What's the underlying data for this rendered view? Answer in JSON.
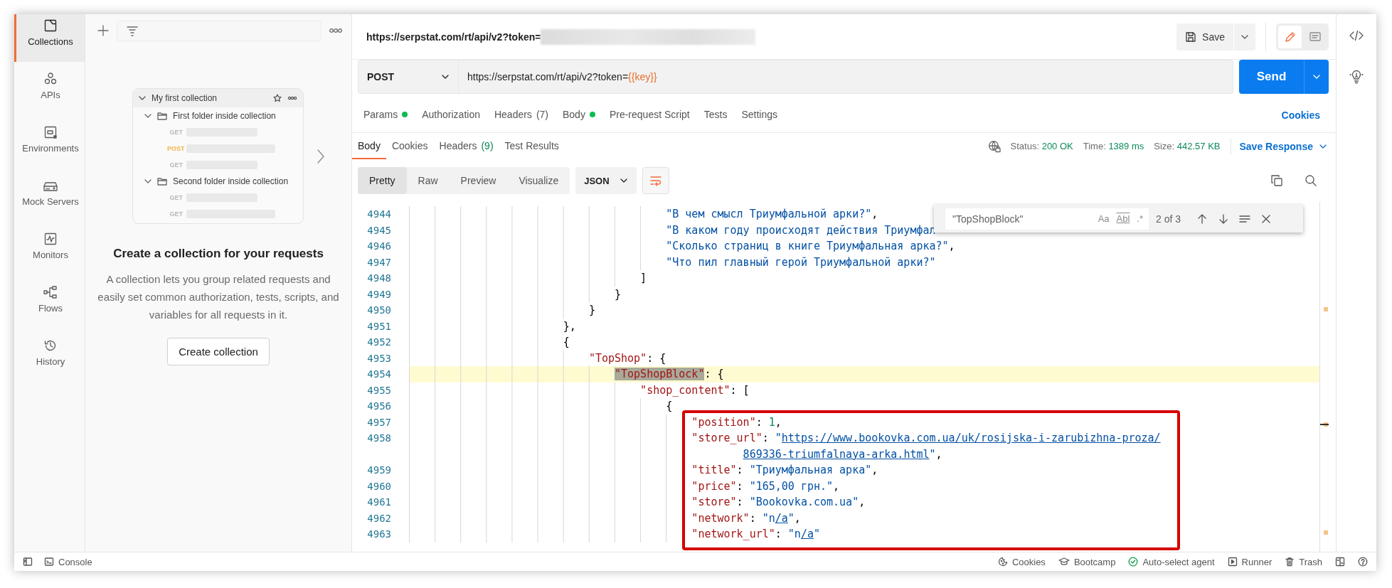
{
  "sidebar": {
    "items": [
      {
        "label": "Collections",
        "kind": "collections",
        "selected": true
      },
      {
        "label": "APIs",
        "kind": "apis",
        "selected": false
      },
      {
        "label": "Environments",
        "kind": "environments",
        "selected": false
      },
      {
        "label": "Mock Servers",
        "kind": "mock_servers",
        "selected": false
      },
      {
        "label": "Monitors",
        "kind": "monitors",
        "selected": false
      },
      {
        "label": "Flows",
        "kind": "flows",
        "selected": false
      },
      {
        "label": "History",
        "kind": "history",
        "selected": false
      }
    ]
  },
  "collections_panel": {
    "illustration": {
      "title": "My first collection",
      "folders": [
        {
          "name": "First folder inside collection",
          "requests": [
            {
              "method": "GET",
              "color": "#b8b8b8"
            },
            {
              "method": "POST",
              "color": "#f2b24c"
            },
            {
              "method": "GET",
              "color": "#b8b8b8"
            }
          ]
        },
        {
          "name": "Second folder inside collection",
          "requests": [
            {
              "method": "GET",
              "color": "#b8b8b8"
            },
            {
              "method": "GET",
              "color": "#b8b8b8"
            }
          ]
        }
      ]
    },
    "heading": "Create a collection for your requests",
    "text": "A collection lets you group related requests and easily set common authorization, tests, scripts, and variables for all requests in it.",
    "button": "Create collection"
  },
  "request_tab": {
    "title": "https://serpstat.com/rt/api/v2?token=",
    "save": "Save",
    "view_modes": [
      {
        "kind": "edit",
        "selected": true
      },
      {
        "kind": "comments",
        "selected": false
      }
    ]
  },
  "request": {
    "method": "POST",
    "url": [
      {
        "kind": "text",
        "text": "https://serpstat.com/rt/api/v2?token="
      },
      {
        "kind": "variable",
        "text": "{{key}}"
      }
    ],
    "send": "Send"
  },
  "request_tabs": [
    {
      "label": "Params",
      "dot": true,
      "selected": false
    },
    {
      "label": "Authorization",
      "dot": false,
      "selected": false
    },
    {
      "label": "Headers",
      "count": "(7)",
      "dot": false,
      "selected": false
    },
    {
      "label": "Body",
      "dot": true,
      "selected": false
    },
    {
      "label": "Pre-request Script",
      "dot": false,
      "selected": false
    },
    {
      "label": "Tests",
      "dot": false,
      "selected": false
    },
    {
      "label": "Settings",
      "dot": false,
      "selected": false
    }
  ],
  "cookies_link": "Cookies",
  "response_tabs": [
    {
      "label": "Body",
      "selected": true
    },
    {
      "label": "Cookies",
      "selected": false
    },
    {
      "label": "Headers",
      "count": "(9)",
      "selected": false
    },
    {
      "label": "Test Results",
      "selected": false
    }
  ],
  "response_meta": [
    {
      "label": "Status:",
      "value": "200 OK"
    },
    {
      "label": "Time:",
      "value": "1389 ms"
    },
    {
      "label": "Size:",
      "value": "442.57 KB"
    }
  ],
  "save_response": "Save Response",
  "view_tabs": [
    {
      "label": "Pretty",
      "selected": true
    },
    {
      "label": "Raw",
      "selected": false
    },
    {
      "label": "Preview",
      "selected": false
    },
    {
      "label": "Visualize",
      "selected": false
    }
  ],
  "format": "JSON",
  "search": {
    "value": "\"TopShopBlock\"",
    "options": [
      {
        "label": "Aa"
      },
      {
        "label": "Abl"
      },
      {
        "label": ".*"
      }
    ],
    "count": "2 of 3"
  },
  "code_lines": [
    {
      "kind": "line",
      "number": "4944",
      "current": false,
      "parts": [
        {
          "kind": "string",
          "text": "                                        \"В чем смысл Триумфальной арки?\""
        },
        {
          "kind": "punct",
          "text": ","
        }
      ]
    },
    {
      "kind": "line",
      "number": "4945",
      "current": false,
      "parts": [
        {
          "kind": "string",
          "text": "                                        \"В каком году происходят действия Триумфал"
        }
      ]
    },
    {
      "kind": "line",
      "number": "4946",
      "current": false,
      "parts": [
        {
          "kind": "string",
          "text": "                                        \"Сколько страниц в книге Триумфальная арка?\""
        },
        {
          "kind": "punct",
          "text": ","
        }
      ]
    },
    {
      "kind": "line",
      "number": "4947",
      "current": false,
      "parts": [
        {
          "kind": "string",
          "text": "                                        \"Что пил главный герой Триумфальной арки?\""
        }
      ]
    },
    {
      "kind": "line",
      "number": "4948",
      "current": false,
      "parts": [
        {
          "kind": "punct",
          "text": "                                    ]"
        }
      ]
    },
    {
      "kind": "line",
      "number": "4949",
      "current": false,
      "parts": [
        {
          "kind": "punct",
          "text": "                                }"
        }
      ]
    },
    {
      "kind": "line",
      "number": "4950",
      "current": false,
      "parts": [
        {
          "kind": "punct",
          "text": "                            }"
        }
      ]
    },
    {
      "kind": "line",
      "number": "4951",
      "current": false,
      "parts": [
        {
          "kind": "punct",
          "text": "                        },"
        }
      ]
    },
    {
      "kind": "line",
      "number": "4952",
      "current": false,
      "parts": [
        {
          "kind": "punct",
          "text": "                        {"
        }
      ]
    },
    {
      "kind": "line",
      "number": "4953",
      "current": false,
      "parts": [
        {
          "kind": "key",
          "text": "                            \"TopShop\""
        },
        {
          "kind": "punct",
          "text": ": {"
        }
      ]
    },
    {
      "kind": "line",
      "number": "4954",
      "current": true,
      "parts": [
        {
          "kind": "match",
          "text": "                                \"TopShopBlock\""
        },
        {
          "kind": "punct",
          "text": ": {"
        }
      ]
    },
    {
      "kind": "line",
      "number": "4955",
      "current": false,
      "parts": [
        {
          "kind": "key",
          "text": "                                    \"shop_content\""
        },
        {
          "kind": "punct",
          "text": ": ["
        }
      ]
    },
    {
      "kind": "line",
      "number": "4956",
      "current": false,
      "parts": [
        {
          "kind": "punct",
          "text": "                                        {"
        }
      ]
    },
    {
      "kind": "framed_block",
      "lines": [
        {
          "number": "4957",
          "current": false,
          "parts": [
            {
              "kind": "key",
              "text": "                                            \"position\""
            },
            {
              "kind": "punct",
              "text": ": "
            },
            {
              "kind": "number",
              "text": "1"
            },
            {
              "kind": "punct",
              "text": ","
            }
          ]
        },
        {
          "number": "4958",
          "current": false,
          "parts": [
            {
              "kind": "key",
              "text": "                                            \"store_url\""
            },
            {
              "kind": "punct",
              "text": ": "
            },
            {
              "kind": "string",
              "text": "\""
            },
            {
              "kind": "link",
              "text": "https://www.bookovka.com.ua/uk/rosijska-i-zarubizhna-proza/"
            }
          ],
          "wrap": [
            {
              "kind": "link",
              "text": "                                                    869336-triumfalnaya-arka.html"
            },
            {
              "kind": "string",
              "text": "\""
            },
            {
              "kind": "punct",
              "text": ","
            }
          ]
        },
        {
          "number": "4959",
          "current": false,
          "parts": [
            {
              "kind": "key",
              "text": "                                            \"title\""
            },
            {
              "kind": "punct",
              "text": ": "
            },
            {
              "kind": "string",
              "text": "\"Триумфальная арка\""
            },
            {
              "kind": "punct",
              "text": ","
            }
          ]
        },
        {
          "number": "4960",
          "current": false,
          "parts": [
            {
              "kind": "key",
              "text": "                                            \"price\""
            },
            {
              "kind": "punct",
              "text": ": "
            },
            {
              "kind": "string",
              "text": "\"165,00 грн.\""
            },
            {
              "kind": "punct",
              "text": ","
            }
          ]
        },
        {
          "number": "4961",
          "current": false,
          "parts": [
            {
              "kind": "key",
              "text": "                                            \"store\""
            },
            {
              "kind": "punct",
              "text": ": "
            },
            {
              "kind": "string",
              "text": "\"Bookovka.com.ua\""
            },
            {
              "kind": "punct",
              "text": ","
            }
          ]
        },
        {
          "number": "4962",
          "current": false,
          "parts": [
            {
              "kind": "key",
              "text": "                                            \"network\""
            },
            {
              "kind": "punct",
              "text": ": "
            },
            {
              "kind": "string",
              "text": "\"n"
            },
            {
              "kind": "link",
              "text": "/a"
            },
            {
              "kind": "string",
              "text": "\""
            },
            {
              "kind": "punct",
              "text": ","
            }
          ]
        },
        {
          "number": "4963",
          "current": false,
          "parts": [
            {
              "kind": "key",
              "text": "                                            \"network_url\""
            },
            {
              "kind": "punct",
              "text": ": "
            },
            {
              "kind": "string",
              "text": "\"n"
            },
            {
              "kind": "link",
              "text": "/a"
            },
            {
              "kind": "string",
              "text": "\""
            }
          ]
        }
      ]
    }
  ],
  "status_bar": {
    "left": [
      {
        "kind": "console",
        "label": "Console"
      }
    ],
    "right": [
      {
        "kind": "cookies",
        "label": "Cookies"
      },
      {
        "kind": "bootcamp",
        "label": "Bootcamp"
      },
      {
        "kind": "agent",
        "label": "Auto-select agent"
      },
      {
        "kind": "runner",
        "label": "Runner"
      },
      {
        "kind": "trash",
        "label": "Trash"
      }
    ]
  }
}
